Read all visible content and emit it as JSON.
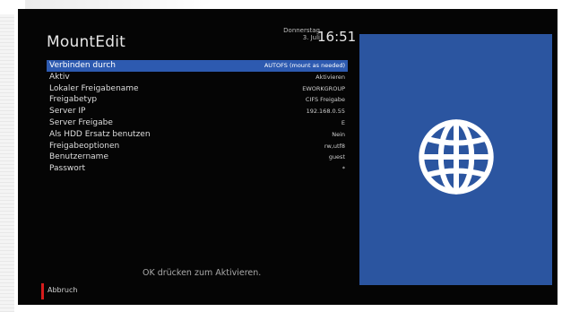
{
  "header": {
    "title": "MountEdit",
    "date_line1": "Donnerstag",
    "date_line2": "3. Juli",
    "time": "16:51"
  },
  "settings": [
    {
      "label": "Verbinden durch",
      "value": "AUTOFS (mount as needed)",
      "selected": true
    },
    {
      "label": "Aktiv",
      "value": "Aktivieren"
    },
    {
      "label": "Lokaler Freigabename",
      "value": "EWORKGROUP"
    },
    {
      "label": "Freigabetyp",
      "value": "CIFS Freigabe"
    },
    {
      "label": "Server IP",
      "value": "192.168.0.55"
    },
    {
      "label": "Server Freigabe",
      "value": "E"
    },
    {
      "label": "Als HDD Ersatz benutzen",
      "value": "Nein"
    },
    {
      "label": "Freigabeoptionen",
      "value": "rw,utf8"
    },
    {
      "label": "Benutzername",
      "value": "guest"
    },
    {
      "label": "Passwort",
      "value": "*"
    }
  ],
  "footer": {
    "hint": "OK drücken zum Aktivieren.",
    "red_button_label": "Abbruch"
  },
  "colors": {
    "selection": "#2d5ab0",
    "preview_panel": "#2b55a0",
    "red_key": "#d61c1c",
    "background": "#050505"
  },
  "icons": {
    "preview": "globe-icon"
  }
}
